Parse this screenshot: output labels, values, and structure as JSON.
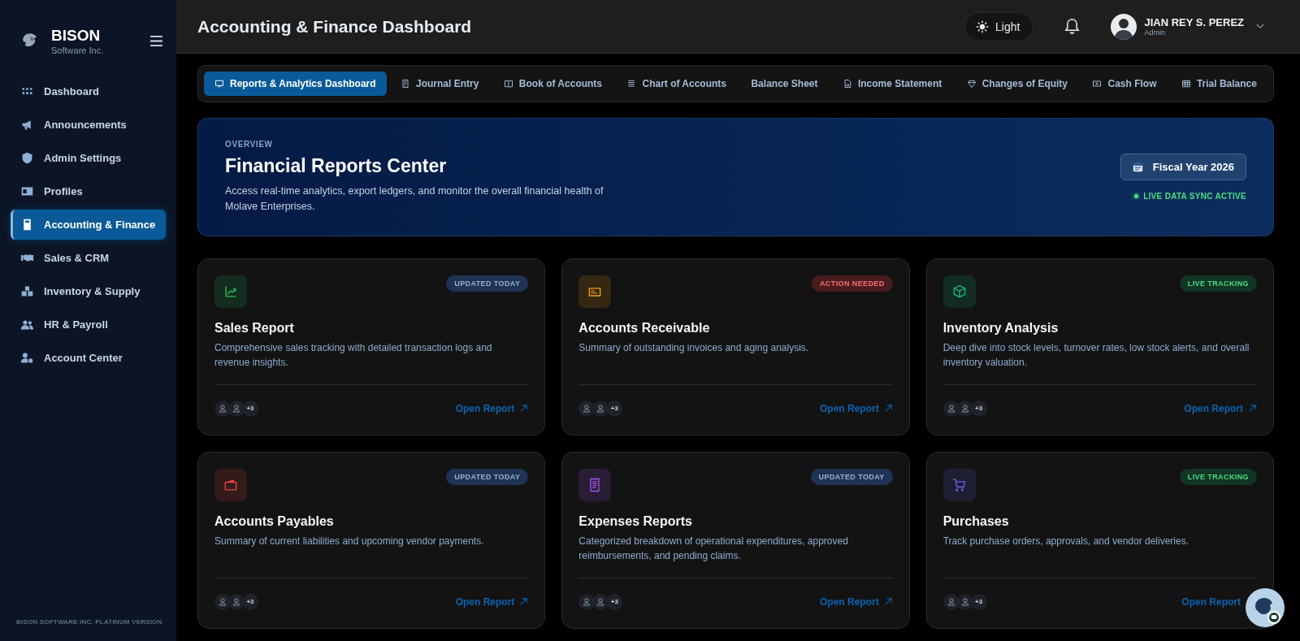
{
  "sidebar": {
    "brand": "BISON",
    "subtitle": "Software Inc.",
    "items": [
      {
        "label": "Dashboard",
        "selected": false
      },
      {
        "label": "Announcements",
        "selected": false
      },
      {
        "label": "Admin Settings",
        "selected": false
      },
      {
        "label": "Profiles",
        "selected": false
      },
      {
        "label": "Accounting & Finance",
        "selected": true
      },
      {
        "label": "Sales & CRM",
        "selected": false
      },
      {
        "label": "Inventory & Supply",
        "selected": false
      },
      {
        "label": "HR & Payroll",
        "selected": false
      },
      {
        "label": "Account Center",
        "selected": false
      }
    ],
    "footer": "BISON SOFTWARE INC. PLATINUM VERSION"
  },
  "header": {
    "title": "Accounting & Finance Dashboard",
    "theme_button": "Light",
    "user": {
      "name": "JIAN REY S. PEREZ",
      "role": "Admin"
    }
  },
  "tabs": [
    {
      "label": "Reports & Analytics Dashboard",
      "selected": true
    },
    {
      "label": "Journal Entry",
      "selected": false
    },
    {
      "label": "Book of Accounts",
      "selected": false
    },
    {
      "label": "Chart of Accounts",
      "selected": false
    },
    {
      "label": "Balance Sheet",
      "selected": false
    },
    {
      "label": "Income Statement",
      "selected": false
    },
    {
      "label": "Changes of Equity",
      "selected": false
    },
    {
      "label": "Cash Flow",
      "selected": false
    },
    {
      "label": "Trial Balance",
      "selected": false
    }
  ],
  "overview": {
    "eyebrow": "OVERVIEW",
    "title": "Financial Reports Center",
    "description": "Access real-time analytics, export ledgers, and monitor the overall financial health of Molave Enterprises.",
    "fiscal_button": "Fiscal Year 2026",
    "status": "LIVE DATA SYNC ACTIVE"
  },
  "cards": [
    {
      "title": "Sales Report",
      "description": "Comprehensive sales tracking with detailed transaction logs and revenue insights.",
      "badge": {
        "text": "UPDATED TODAY",
        "kind": "updated"
      },
      "color": "#22c55e",
      "more": "+3",
      "link": "Open Report"
    },
    {
      "title": "Accounts Receivable",
      "description": "Summary of outstanding invoices and aging analysis.",
      "badge": {
        "text": "ACTION NEEDED",
        "kind": "action"
      },
      "color": "#f59e0b",
      "more": "+3",
      "link": "Open Report"
    },
    {
      "title": "Inventory Analysis",
      "description": "Deep dive into stock levels, turnover rates, low stock alerts, and overall inventory valuation.",
      "badge": {
        "text": "LIVE TRACKING",
        "kind": "live"
      },
      "color": "#10b981",
      "more": "+3",
      "link": "Open Report"
    },
    {
      "title": "Accounts Payables",
      "description": "Summary of current liabilities and upcoming vendor payments.",
      "badge": {
        "text": "UPDATED TODAY",
        "kind": "updated"
      },
      "color": "#ef4444",
      "more": "+3",
      "link": "Open Report"
    },
    {
      "title": "Expenses Reports",
      "description": "Categorized breakdown of operational expenditures, approved reimbursements, and pending claims.",
      "badge": {
        "text": "UPDATED TODAY",
        "kind": "updated"
      },
      "color": "#a855f7",
      "more": "+3",
      "link": "Open Report"
    },
    {
      "title": "Purchases",
      "description": "Track purchase orders, approvals, and vendor deliveries.",
      "badge": {
        "text": "LIVE TRACKING",
        "kind": "live"
      },
      "color": "#6366f1",
      "more": "+3",
      "link": "Open Report"
    }
  ]
}
